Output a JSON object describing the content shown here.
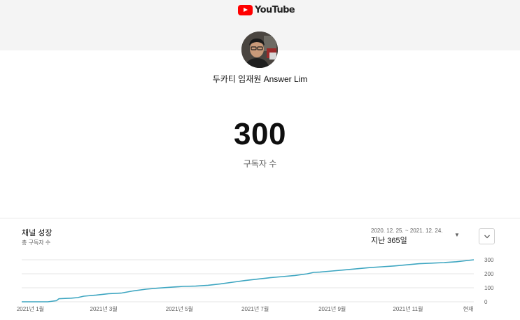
{
  "header": {
    "logo_text": "YouTube"
  },
  "channel": {
    "name": "두카티 임재원 Answer Lim"
  },
  "subscribers": {
    "count": "300",
    "label": "구독자 수"
  },
  "growth": {
    "title": "채널 성장",
    "subtitle": "총 구독자 수",
    "date_range": "2020. 12. 25. ~ 2021. 12. 24.",
    "period_label": "지난 365일"
  },
  "colors": {
    "line": "#3ea6c1",
    "grid": "#e5e5e5",
    "brand_red": "#ff0000"
  },
  "chart_data": {
    "type": "line",
    "title": "",
    "xlabel": "",
    "ylabel": "",
    "x_tick_labels": [
      "2021년 1월",
      "2021년 3월",
      "2021년 5월",
      "2021년 7월",
      "2021년 9월",
      "2021년 11월",
      "현재"
    ],
    "x_tick_days": [
      7,
      66,
      127,
      188,
      250,
      311,
      364
    ],
    "y_ticks": [
      0,
      100,
      200,
      300
    ],
    "ylim": [
      0,
      300
    ],
    "xlim": [
      0,
      364
    ],
    "grid": true,
    "series": [
      {
        "x": [
          0,
          10,
          20,
          21,
          28,
          30,
          35,
          40,
          45,
          50,
          60,
          70,
          80,
          90,
          100,
          110,
          120,
          130,
          140,
          150,
          160,
          170,
          180,
          190,
          200,
          210,
          220,
          230,
          235,
          240,
          250,
          260,
          270,
          280,
          290,
          300,
          310,
          320,
          330,
          340,
          350,
          364
        ],
        "y": [
          0,
          0,
          0,
          0,
          8,
          22,
          24,
          26,
          30,
          40,
          48,
          58,
          62,
          78,
          90,
          98,
          104,
          110,
          112,
          118,
          128,
          140,
          152,
          162,
          172,
          180,
          188,
          200,
          210,
          212,
          220,
          228,
          236,
          244,
          250,
          256,
          264,
          272,
          276,
          280,
          286,
          300
        ]
      }
    ]
  }
}
